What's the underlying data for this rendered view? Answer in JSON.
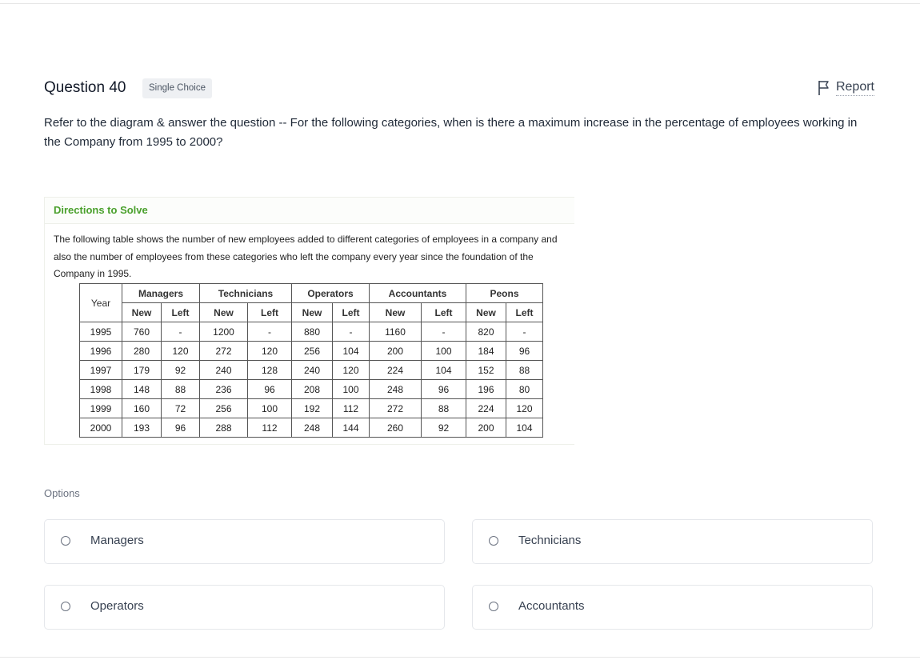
{
  "question": {
    "title": "Question 40",
    "type_badge": "Single Choice",
    "report_label": "Report",
    "text": "Refer to the diagram & answer the question -- For the following categories, when is there a maximum increase in the percentage of employees working in the Company from 1995 to 2000?"
  },
  "directions": {
    "heading": "Directions to Solve",
    "text": "The following table shows the number of new employees added to different categories of employees in a company and also the number of employees from these categories who left the company every year since the foundation of the Company in 1995.",
    "table": {
      "year_header": "Year",
      "categories": [
        "Managers",
        "Technicians",
        "Operators",
        "Accountants",
        "Peons"
      ],
      "sub_headers": [
        "New",
        "Left"
      ],
      "rows": [
        [
          "1995",
          "760",
          "-",
          "1200",
          "-",
          "880",
          "-",
          "1160",
          "-",
          "820",
          "-"
        ],
        [
          "1996",
          "280",
          "120",
          "272",
          "120",
          "256",
          "104",
          "200",
          "100",
          "184",
          "96"
        ],
        [
          "1997",
          "179",
          "92",
          "240",
          "128",
          "240",
          "120",
          "224",
          "104",
          "152",
          "88"
        ],
        [
          "1998",
          "148",
          "88",
          "236",
          "96",
          "208",
          "100",
          "248",
          "96",
          "196",
          "80"
        ],
        [
          "1999",
          "160",
          "72",
          "256",
          "100",
          "192",
          "112",
          "272",
          "88",
          "224",
          "120"
        ],
        [
          "2000",
          "193",
          "96",
          "288",
          "112",
          "248",
          "144",
          "260",
          "92",
          "200",
          "104"
        ]
      ]
    }
  },
  "options": {
    "label": "Options",
    "items": [
      {
        "label": "Managers"
      },
      {
        "label": "Technicians"
      },
      {
        "label": "Operators"
      },
      {
        "label": "Accountants"
      }
    ]
  },
  "colors": {
    "directions_heading": "#4aa02c",
    "badge_bg": "#eef0f3",
    "option_border": "#e5e7eb"
  },
  "icons": {
    "report": "flag-icon",
    "option_radio": "radio-icon"
  }
}
